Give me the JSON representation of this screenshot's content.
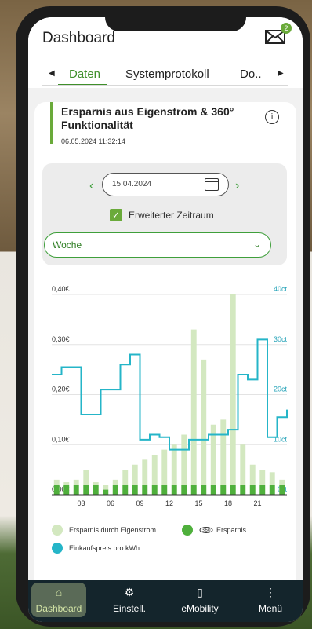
{
  "header": {
    "title": "Dashboard",
    "badge": "2"
  },
  "tabs": [
    {
      "label": "Daten"
    },
    {
      "label": "Systemprotokoll"
    },
    {
      "label": "Do.."
    }
  ],
  "card": {
    "title": "Ersparnis aus Eigenstrom & 360° Funktionalität",
    "date": "06.05.2024 11:32:14"
  },
  "filter": {
    "date_value": "15.04.2024",
    "checkbox_label": "Erweiterter Zeitraum",
    "select_value": "Woche"
  },
  "colors": {
    "accent": "#3f8f2b",
    "bar_light": "#d3e8c0",
    "bar_dark": "#4fb03c",
    "line": "#25b5c8"
  },
  "chart_data": {
    "type": "bar",
    "x_ticks": [
      "03",
      "06",
      "09",
      "12",
      "15",
      "18",
      "21"
    ],
    "y_left_ticks": [
      "0,00€",
      "0,10€",
      "0,20€",
      "0,30€",
      "0,40€"
    ],
    "y_right_ticks": [
      "0ct",
      "10ct",
      "20ct",
      "30ct",
      "40ct"
    ],
    "ylim_left": [
      0,
      0.4
    ],
    "ylim_right": [
      0,
      40
    ],
    "hours": [
      0,
      1,
      2,
      3,
      4,
      5,
      6,
      7,
      8,
      9,
      10,
      11,
      12,
      13,
      14,
      15,
      16,
      17,
      18,
      19,
      20,
      21,
      22,
      23
    ],
    "series": [
      {
        "name": "Ersparnis durch Eigenstrom",
        "axis": "left",
        "values": [
          0.03,
          0.025,
          0.03,
          0.05,
          0.025,
          0.02,
          0.03,
          0.05,
          0.06,
          0.07,
          0.08,
          0.09,
          0.1,
          0.12,
          0.33,
          0.27,
          0.14,
          0.15,
          0.4,
          0.1,
          0.06,
          0.05,
          0.045,
          0.03
        ]
      },
      {
        "name": "360° Ersparnis",
        "axis": "left",
        "values": [
          0.02,
          0.02,
          0.02,
          0.02,
          0.02,
          0.01,
          0.02,
          0.02,
          0.02,
          0.02,
          0.02,
          0.02,
          0.02,
          0.02,
          0.02,
          0.02,
          0.02,
          0.02,
          0.02,
          0.02,
          0.02,
          0.02,
          0.02,
          0.02
        ]
      },
      {
        "name": "Einkaufspreis pro kWh",
        "axis": "right",
        "values": [
          24,
          25.5,
          25.5,
          16,
          16,
          21,
          21,
          26,
          28,
          11,
          12,
          11.5,
          9,
          9,
          11,
          11,
          12,
          12,
          13,
          24,
          23,
          31,
          11.5,
          15.5,
          17
        ]
      }
    ]
  },
  "legend": [
    {
      "label": "Ersparnis durch Eigenstrom"
    },
    {
      "label": "Ersparnis"
    },
    {
      "label": "Einkaufspreis pro kWh"
    }
  ],
  "nav": [
    {
      "label": "Dashboard",
      "icon": "home-icon"
    },
    {
      "label": "Einstell.",
      "icon": "gears-icon"
    },
    {
      "label": "eMobility",
      "icon": "charger-icon"
    },
    {
      "label": "Menü",
      "icon": "more-vertical-icon"
    }
  ]
}
